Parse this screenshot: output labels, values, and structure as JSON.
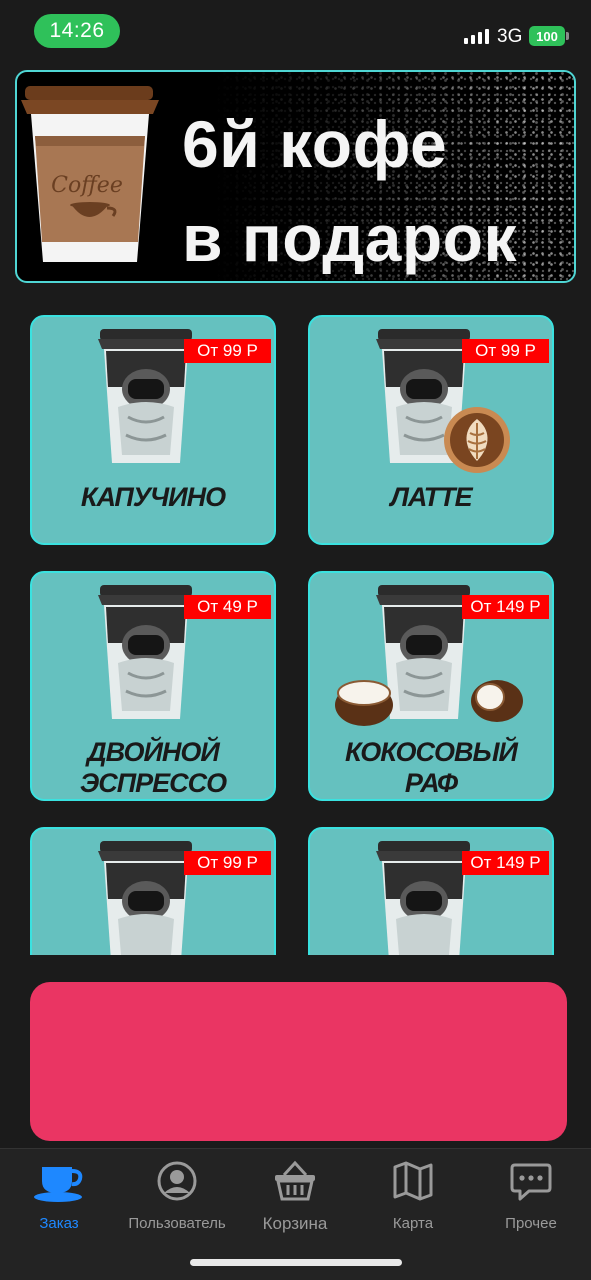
{
  "status_bar": {
    "time": "14:26",
    "network": "3G",
    "battery": "100"
  },
  "banner": {
    "line1": "6й кофе",
    "line2": "в подарок",
    "cup_text": "Coffee"
  },
  "products": [
    {
      "name_lines": [
        "Капучино"
      ],
      "price": "От 99 Р",
      "extra": "none"
    },
    {
      "name_lines": [
        "Латте"
      ],
      "price": "От 99 Р",
      "extra": "latte-art"
    },
    {
      "name_lines": [
        "Двойной",
        "эспрессо"
      ],
      "price": "От 49 Р",
      "extra": "none"
    },
    {
      "name_lines": [
        "Кокосовый",
        "раф"
      ],
      "price": "От 149 Р",
      "extra": "coconut"
    },
    {
      "name_lines": [
        ""
      ],
      "price": "От 99 Р",
      "extra": "none"
    },
    {
      "name_lines": [
        ""
      ],
      "price": "От 149 Р",
      "extra": "none"
    }
  ],
  "tabs": [
    {
      "label": "Заказ",
      "icon": "coffee-cup-icon",
      "active": true
    },
    {
      "label": "Пользователь",
      "icon": "user-icon",
      "active": false
    },
    {
      "label": "Корзина",
      "icon": "basket-icon",
      "active": false
    },
    {
      "label": "Карта",
      "icon": "map-icon",
      "active": false
    },
    {
      "label": "Прочее",
      "icon": "chat-icon",
      "active": false
    }
  ],
  "colors": {
    "card_bg": "#65c1bf",
    "card_border": "#3ae2e0",
    "price_tag": "#ff0000",
    "pink_block": "#ea3563",
    "accent": "#1e88ff",
    "time_pill": "#2fc15a"
  }
}
